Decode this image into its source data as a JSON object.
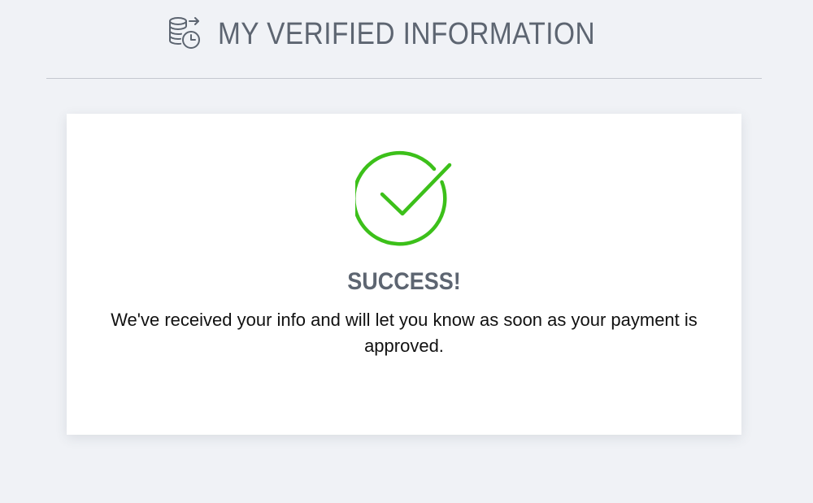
{
  "header": {
    "title": "MY VERIFIED INFORMATION",
    "icon": "coins-clock-icon"
  },
  "card": {
    "status_icon": "check-circle-icon",
    "heading": "SUCCESS!",
    "message": "We've received your info and will let you know as soon as your payment is approved."
  },
  "colors": {
    "background": "#f0f2f6",
    "card": "#ffffff",
    "heading_text": "#5d6571",
    "body_text": "#111111",
    "success_green": "#3cc01a",
    "divider": "#c4c8d0"
  }
}
